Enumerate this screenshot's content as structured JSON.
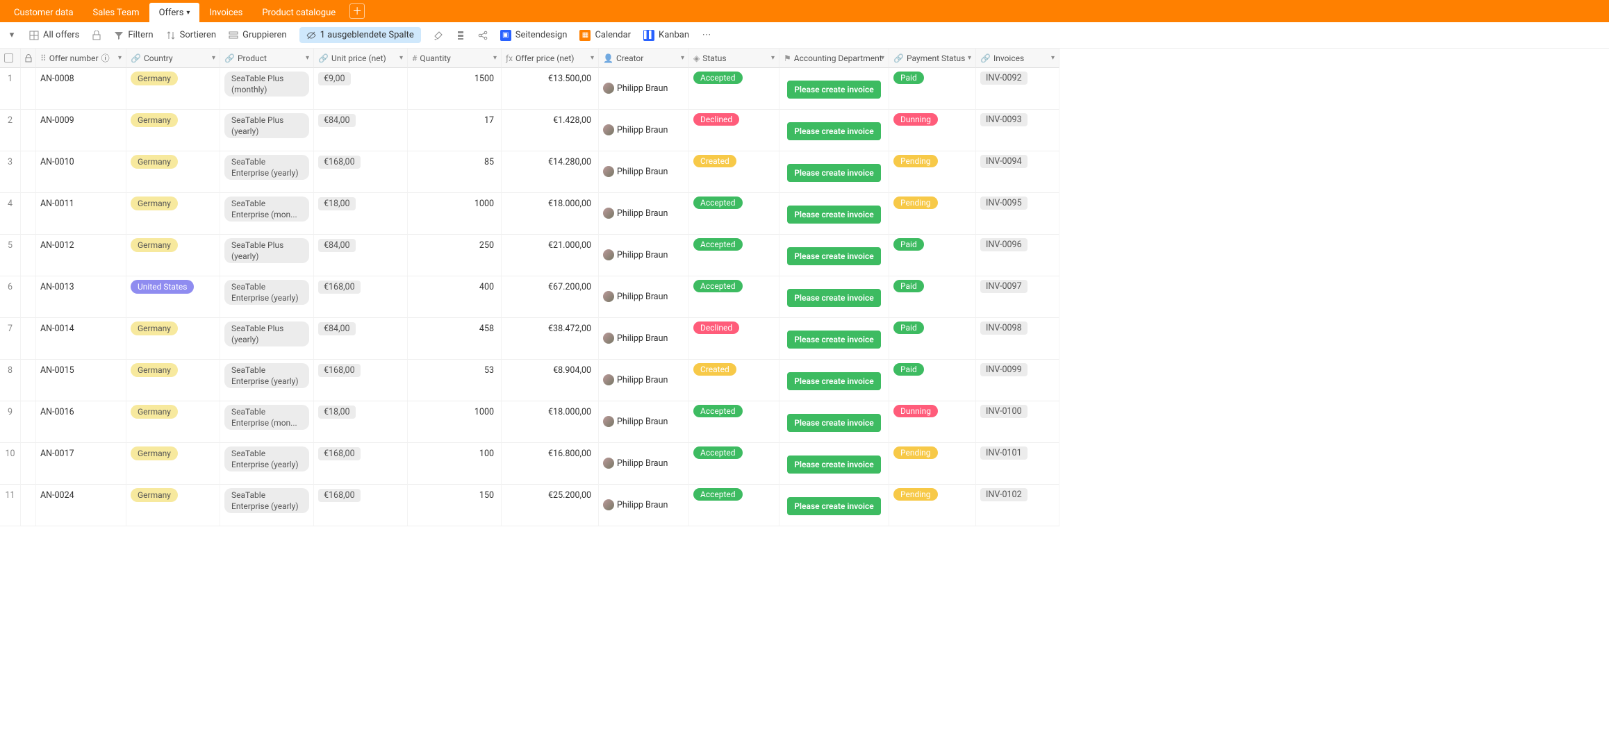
{
  "tabs": {
    "customer_data": "Customer data",
    "sales_team": "Sales Team",
    "offers": "Offers",
    "invoices": "Invoices",
    "product_catalogue": "Product catalogue"
  },
  "toolbar": {
    "view_name": "All offers",
    "filter": "Filtern",
    "sort": "Sortieren",
    "group": "Gruppieren",
    "hidden_col": "1 ausgeblendete Spalte",
    "page_design": "Seitendesign",
    "calendar": "Calendar",
    "kanban": "Kanban"
  },
  "columns": {
    "offer_number": "Offer number",
    "country": "Country",
    "product": "Product",
    "unit_price": "Unit price (net)",
    "quantity": "Quantity",
    "offer_price": "Offer price (net)",
    "creator": "Creator",
    "status": "Status",
    "accounting": "Accounting Department",
    "payment_status": "Payment Status",
    "invoices": "Invoices"
  },
  "strings": {
    "create_invoice_btn": "Please create invoice"
  },
  "status_labels": {
    "accepted": "Accepted",
    "declined": "Declined",
    "created": "Created"
  },
  "payment_labels": {
    "paid": "Paid",
    "dunning": "Dunning",
    "pending": "Pending"
  },
  "country_labels": {
    "germany": "Germany",
    "us": "United States"
  },
  "rows": [
    {
      "num": "1",
      "offer": "AN-0008",
      "country": "germany",
      "product": "SeaTable Plus (monthly)",
      "unit_price": "€9,00",
      "qty": "1500",
      "offer_price": "€13.500,00",
      "creator": "Philipp Braun",
      "status": "accepted",
      "payment": "paid",
      "invoice": "INV-0092"
    },
    {
      "num": "2",
      "offer": "AN-0009",
      "country": "germany",
      "product": "SeaTable Plus (yearly)",
      "unit_price": "€84,00",
      "qty": "17",
      "offer_price": "€1.428,00",
      "creator": "Philipp Braun",
      "status": "declined",
      "payment": "dunning",
      "invoice": "INV-0093"
    },
    {
      "num": "3",
      "offer": "AN-0010",
      "country": "germany",
      "product": "SeaTable Enterprise (yearly)",
      "unit_price": "€168,00",
      "qty": "85",
      "offer_price": "€14.280,00",
      "creator": "Philipp Braun",
      "status": "created",
      "payment": "pending",
      "invoice": "INV-0094"
    },
    {
      "num": "4",
      "offer": "AN-0011",
      "country": "germany",
      "product": "SeaTable Enterprise (mon...",
      "unit_price": "€18,00",
      "qty": "1000",
      "offer_price": "€18.000,00",
      "creator": "Philipp Braun",
      "status": "accepted",
      "payment": "pending",
      "invoice": "INV-0095"
    },
    {
      "num": "5",
      "offer": "AN-0012",
      "country": "germany",
      "product": "SeaTable Plus (yearly)",
      "unit_price": "€84,00",
      "qty": "250",
      "offer_price": "€21.000,00",
      "creator": "Philipp Braun",
      "status": "accepted",
      "payment": "paid",
      "invoice": "INV-0096"
    },
    {
      "num": "6",
      "offer": "AN-0013",
      "country": "us",
      "product": "SeaTable Enterprise (yearly)",
      "unit_price": "€168,00",
      "qty": "400",
      "offer_price": "€67.200,00",
      "creator": "Philipp Braun",
      "status": "accepted",
      "payment": "paid",
      "invoice": "INV-0097"
    },
    {
      "num": "7",
      "offer": "AN-0014",
      "country": "germany",
      "product": "SeaTable Plus (yearly)",
      "unit_price": "€84,00",
      "qty": "458",
      "offer_price": "€38.472,00",
      "creator": "Philipp Braun",
      "status": "declined",
      "payment": "paid",
      "invoice": "INV-0098"
    },
    {
      "num": "8",
      "offer": "AN-0015",
      "country": "germany",
      "product": "SeaTable Enterprise (yearly)",
      "unit_price": "€168,00",
      "qty": "53",
      "offer_price": "€8.904,00",
      "creator": "Philipp Braun",
      "status": "created",
      "payment": "paid",
      "invoice": "INV-0099"
    },
    {
      "num": "9",
      "offer": "AN-0016",
      "country": "germany",
      "product": "SeaTable Enterprise (mon...",
      "unit_price": "€18,00",
      "qty": "1000",
      "offer_price": "€18.000,00",
      "creator": "Philipp Braun",
      "status": "accepted",
      "payment": "dunning",
      "invoice": "INV-0100"
    },
    {
      "num": "10",
      "offer": "AN-0017",
      "country": "germany",
      "product": "SeaTable Enterprise (yearly)",
      "unit_price": "€168,00",
      "qty": "100",
      "offer_price": "€16.800,00",
      "creator": "Philipp Braun",
      "status": "accepted",
      "payment": "pending",
      "invoice": "INV-0101"
    },
    {
      "num": "11",
      "offer": "AN-0024",
      "country": "germany",
      "product": "SeaTable Enterprise (yearly)",
      "unit_price": "€168,00",
      "qty": "150",
      "offer_price": "€25.200,00",
      "creator": "Philipp Braun",
      "status": "accepted",
      "payment": "pending",
      "invoice": "INV-0102"
    }
  ]
}
